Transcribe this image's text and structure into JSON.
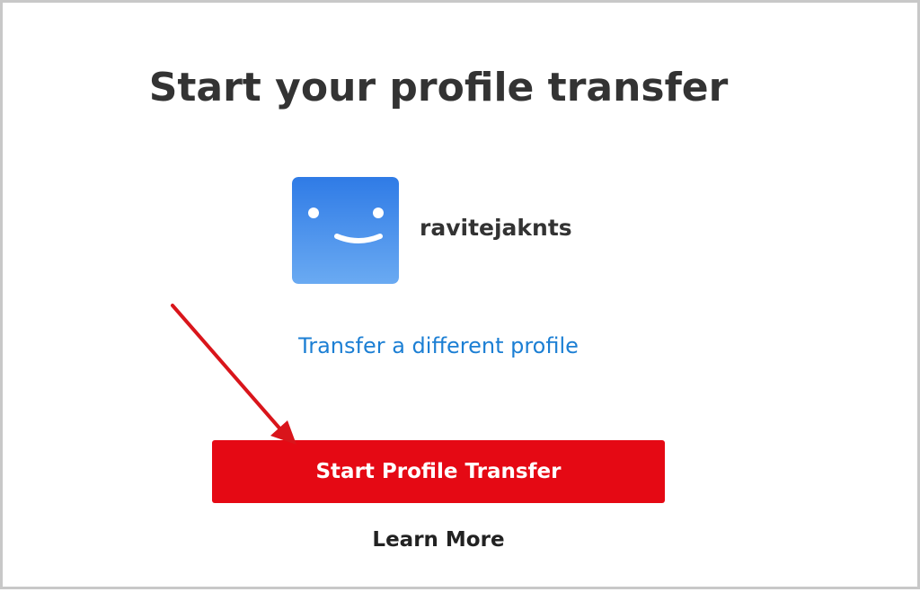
{
  "page": {
    "title": "Start your profile transfer"
  },
  "profile": {
    "name": "ravitejaknts",
    "avatar_icon": "smiley-face-icon",
    "avatar_colors": {
      "top": "#2f7be6",
      "bottom": "#6aaaf2"
    }
  },
  "links": {
    "transfer_different": "Transfer a different profile"
  },
  "actions": {
    "start_label": "Start Profile Transfer",
    "learn_more_label": "Learn More"
  },
  "annotation": {
    "arrow_icon": "red-arrow-icon",
    "color": "#d9151b"
  },
  "colors": {
    "primary_button": "#e50914",
    "link": "#1c7fd4",
    "text": "#333333"
  }
}
